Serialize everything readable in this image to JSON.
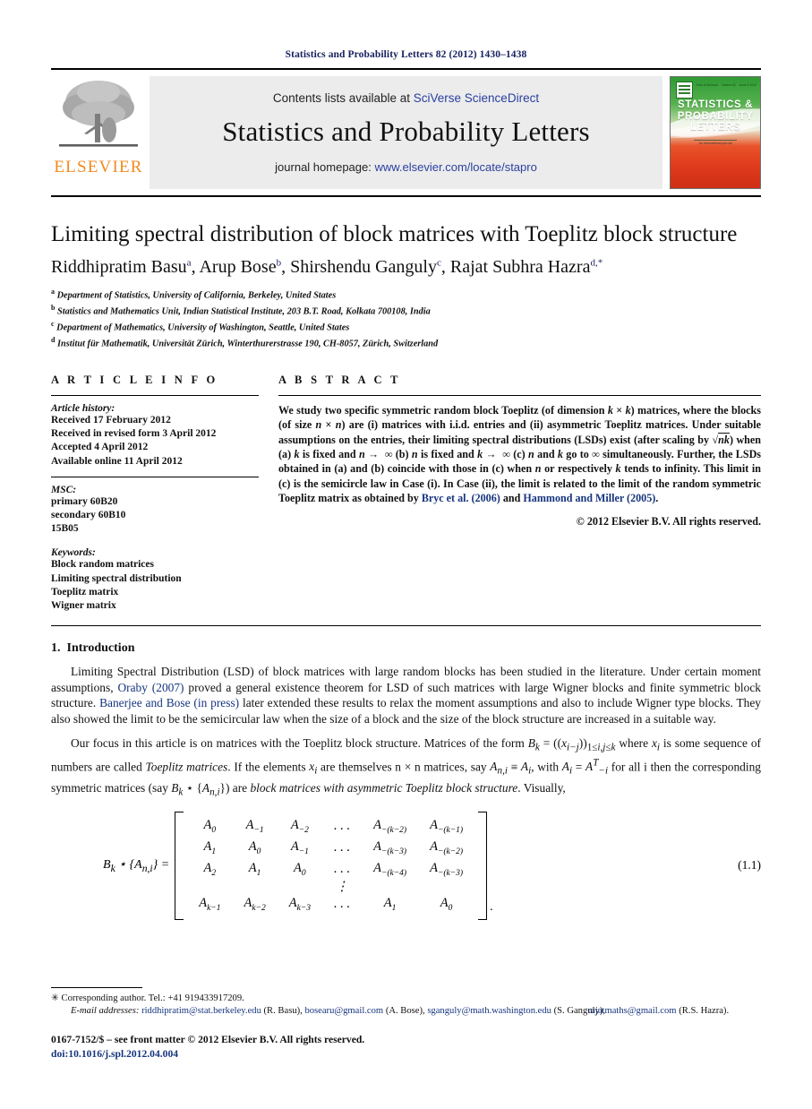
{
  "running_head": "Statistics and Probability Letters 82 (2012) 1430–1438",
  "masthead": {
    "publisher_wordmark": "ELSEVIER",
    "contents_prefix": "Contents lists available at ",
    "contents_link": "SciVerse ScienceDirect",
    "journal_name": "Statistics and Probability Letters",
    "homepage_prefix": "journal homepage: ",
    "homepage_link": "www.elsevier.com/locate/stapro",
    "cover": {
      "title_line1": "STATISTICS &",
      "title_line2": "PROBABILITY",
      "title_line3": "LETTERS",
      "top_labels": [
        "Texts & Methods",
        "Volume 82",
        "Issue 8 2012"
      ],
      "footer_text": "An international journal"
    }
  },
  "article": {
    "title": "Limiting spectral distribution of block matrices with Toeplitz block structure",
    "authors": [
      {
        "name": "Riddhipratim Basu",
        "marks": "a"
      },
      {
        "name": "Arup Bose",
        "marks": "b"
      },
      {
        "name": "Shirshendu Ganguly",
        "marks": "c"
      },
      {
        "name": "Rajat Subhra Hazra",
        "marks": "d,*"
      }
    ],
    "affiliations": [
      {
        "mark": "a",
        "text": "Department of Statistics, University of California, Berkeley, United States"
      },
      {
        "mark": "b",
        "text": "Statistics and Mathematics Unit, Indian Statistical Institute, 203 B.T. Road, Kolkata 700108, India"
      },
      {
        "mark": "c",
        "text": "Department of Mathematics, University of Washington, Seattle, United States"
      },
      {
        "mark": "d",
        "text": "Institut für Mathematik, Universität Zürich, Winterthurerstrasse 190, CH-8057, Zürich, Switzerland"
      }
    ]
  },
  "article_info": {
    "heading": "A R T I C L E    I N F O",
    "history_label": "Article history:",
    "history": [
      "Received 17 February 2012",
      "Received in revised form 3 April 2012",
      "Accepted 4 April 2012",
      "Available online 11 April 2012"
    ],
    "msc_label": "MSC:",
    "msc": [
      "primary 60B20",
      "secondary 60B10",
      "15B05"
    ],
    "keywords_label": "Keywords:",
    "keywords": [
      "Block random matrices",
      "Limiting spectral distribution",
      "Toeplitz matrix",
      "Wigner matrix"
    ]
  },
  "abstract": {
    "heading": "A B S T R A C T",
    "copyright": "© 2012 Elsevier B.V. All rights reserved."
  },
  "introduction": {
    "number": "1.",
    "heading": "Introduction"
  },
  "equation": {
    "lhs": "Bk ⋆ {An,i} =",
    "number": "(1.1)",
    "trailing_comma": ".",
    "rows": [
      [
        "A₀",
        "A₋₁",
        "A₋₂",
        ". . .",
        "A₋(k₋₂)",
        "A₋(k₋₁)"
      ],
      [
        "A₁",
        "A₀",
        "A₋₁",
        ". . .",
        "A₋(k₋₃)",
        "A₋(k₋₂)"
      ],
      [
        "A₂",
        "A₁",
        "A₀",
        ". . .",
        "A₋(k₋₄)",
        "A₋(k₋₃)"
      ],
      [
        "",
        "",
        "",
        "⋮",
        "",
        ""
      ],
      [
        "Ak₋₁",
        "Ak₋₂",
        "Ak₋₃",
        ". . .",
        "A₁",
        "A₀"
      ]
    ]
  },
  "footnotes": {
    "corresponding": "Corresponding author. Tel.: +41 919433917209.",
    "email_label": "E-mail addresses:",
    "emails": [
      {
        "address": "riddhipratim@stat.berkeley.edu",
        "owner": "(R. Basu)"
      },
      {
        "address": "bosearu@gmail.com",
        "owner": "(A. Bose)"
      },
      {
        "address": "sganguly@math.washington.edu",
        "owner": "(S. Ganguly)"
      },
      {
        "address": "rajatmaths@gmail.com",
        "owner": "(R.S. Hazra)"
      }
    ]
  },
  "imprint": {
    "line1": "0167-7152/$ – see front matter © 2012 Elsevier B.V. All rights reserved.",
    "doi": "doi:10.1016/j.spl.2012.04.004"
  },
  "colors": {
    "link": "#16357e",
    "brand_orange": "#f18a22",
    "running_head": "#16205e",
    "band_bg": "#ececed"
  }
}
